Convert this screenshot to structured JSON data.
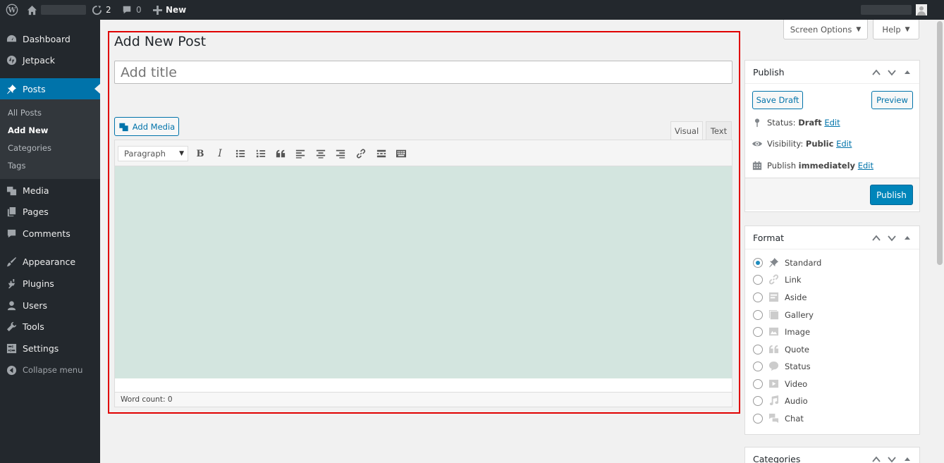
{
  "adminbar": {
    "updates_count": "2",
    "comments_count": "0",
    "new_label": "New"
  },
  "sidebar": {
    "items": [
      {
        "label": "Dashboard",
        "icon": "dashboard-icon"
      },
      {
        "label": "Jetpack",
        "icon": "jetpack-icon"
      },
      {
        "label": "Posts",
        "icon": "pin-icon"
      },
      {
        "label": "Media",
        "icon": "media-icon"
      },
      {
        "label": "Pages",
        "icon": "pages-icon"
      },
      {
        "label": "Comments",
        "icon": "comments-icon"
      },
      {
        "label": "Appearance",
        "icon": "brush-icon"
      },
      {
        "label": "Plugins",
        "icon": "plugin-icon"
      },
      {
        "label": "Users",
        "icon": "users-icon"
      },
      {
        "label": "Tools",
        "icon": "wrench-icon"
      },
      {
        "label": "Settings",
        "icon": "settings-icon"
      }
    ],
    "submenu": [
      "All Posts",
      "Add New",
      "Categories",
      "Tags"
    ],
    "collapse_label": "Collapse menu"
  },
  "top_buttons": {
    "screen_options": "Screen Options",
    "help": "Help"
  },
  "editor": {
    "page_title": "Add New Post",
    "title_placeholder": "Add title",
    "add_media": "Add Media",
    "tab_visual": "Visual",
    "tab_text": "Text",
    "format_select": "Paragraph",
    "word_count": "Word count: 0"
  },
  "publish_box": {
    "title": "Publish",
    "save_draft": "Save Draft",
    "preview": "Preview",
    "status_label": "Status:",
    "status_value": "Draft",
    "visibility_label": "Visibility:",
    "visibility_value": "Public",
    "publish_label": "Publish",
    "publish_value": "immediately",
    "edit": "Edit",
    "publish_button": "Publish"
  },
  "format_box": {
    "title": "Format",
    "options": [
      "Standard",
      "Link",
      "Aside",
      "Gallery",
      "Image",
      "Quote",
      "Status",
      "Video",
      "Audio",
      "Chat"
    ],
    "selected": "Standard"
  },
  "categories_box": {
    "title": "Categories"
  },
  "colors": {
    "accent": "#0073aa",
    "sidebar": "#23282d",
    "highlight_frame": "#e00000",
    "content_bg": "#d3e5df"
  }
}
